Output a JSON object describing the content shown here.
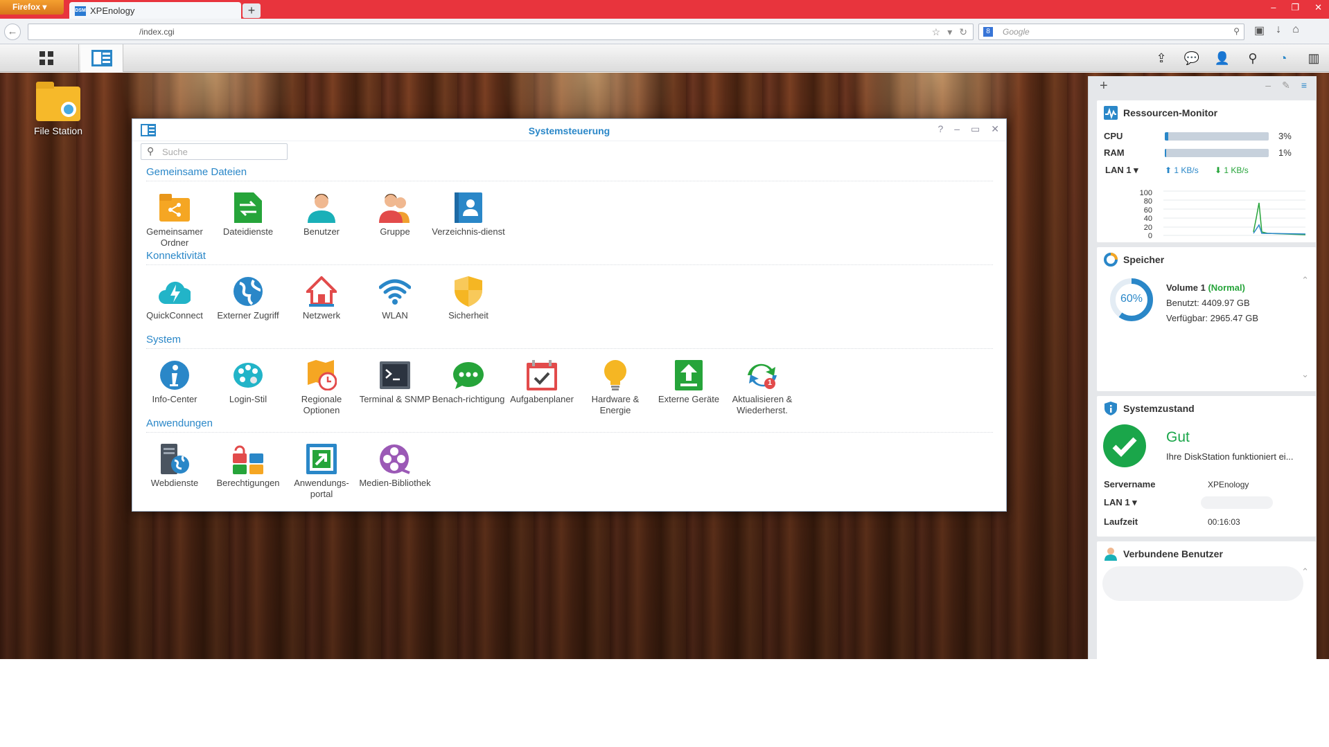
{
  "browser": {
    "menu_label": "Firefox",
    "tab_title": "XPEnology",
    "tab_favicon": "DSM",
    "new_tab": "+",
    "url": "/index.cgi",
    "search_placeholder": "Google"
  },
  "desktop": {
    "file_station_label": "File Station"
  },
  "window": {
    "title": "Systemsteuerung",
    "search_placeholder": "Suche",
    "sections": {
      "shared": {
        "title": "Gemeinsame Dateien",
        "items": [
          {
            "label": "Gemeinsamer Ordner",
            "icon": "shared-folder-icon"
          },
          {
            "label": "Dateidienste",
            "icon": "file-services-icon"
          },
          {
            "label": "Benutzer",
            "icon": "user-icon"
          },
          {
            "label": "Gruppe",
            "icon": "group-icon"
          },
          {
            "label": "Verzeichnis-dienst",
            "icon": "directory-icon"
          }
        ]
      },
      "connectivity": {
        "title": "Konnektivität",
        "items": [
          {
            "label": "QuickConnect",
            "icon": "quickconnect-icon"
          },
          {
            "label": "Externer Zugriff",
            "icon": "globe-icon"
          },
          {
            "label": "Netzwerk",
            "icon": "home-network-icon"
          },
          {
            "label": "WLAN",
            "icon": "wifi-icon"
          },
          {
            "label": "Sicherheit",
            "icon": "shield-icon"
          }
        ]
      },
      "system": {
        "title": "System",
        "items": [
          {
            "label": "Info-Center",
            "icon": "info-icon"
          },
          {
            "label": "Login-Stil",
            "icon": "palette-icon"
          },
          {
            "label": "Regionale Optionen",
            "icon": "region-clock-icon"
          },
          {
            "label": "Terminal & SNMP",
            "icon": "terminal-icon"
          },
          {
            "label": "Benach-richtigung",
            "icon": "chat-bubble-icon"
          },
          {
            "label": "Aufgabenplaner",
            "icon": "calendar-check-icon"
          },
          {
            "label": "Hardware & Energie",
            "icon": "lightbulb-icon"
          },
          {
            "label": "Externe Geräte",
            "icon": "upload-device-icon"
          },
          {
            "label": "Aktualisieren & Wiederherst.",
            "icon": "update-icon",
            "badge": "1"
          }
        ]
      },
      "apps": {
        "title": "Anwendungen",
        "items": [
          {
            "label": "Webdienste",
            "icon": "web-services-icon"
          },
          {
            "label": "Berechtigungen",
            "icon": "privileges-icon"
          },
          {
            "label": "Anwendungs-portal",
            "icon": "app-portal-icon"
          },
          {
            "label": "Medien-Bibliothek",
            "icon": "media-library-icon"
          }
        ]
      }
    }
  },
  "widgets": {
    "resource_monitor": {
      "title": "Ressourcen-Monitor",
      "cpu_label": "CPU",
      "cpu_value": "3%",
      "cpu_fraction": 0.03,
      "ram_label": "RAM",
      "ram_value": "1%",
      "ram_fraction": 0.01,
      "lan_label": "LAN 1",
      "up": "1 KB/s",
      "down": "1 KB/s",
      "chart_ticks": [
        "100",
        "80",
        "60",
        "40",
        "20",
        "0"
      ]
    },
    "storage": {
      "title": "Speicher",
      "percent_label": "60%",
      "percent": 60,
      "volume_name": "Volume 1",
      "volume_status": "(Normal)",
      "used": "Benutzt: 4409.97 GB",
      "free": "Verfügbar: 2965.47 GB"
    },
    "health": {
      "title": "Systemzustand",
      "status": "Gut",
      "message": "Ihre DiskStation funktioniert ei...",
      "server_label": "Servername",
      "server_value": "XPEnology",
      "lan_label": "LAN 1",
      "uptime_label": "Laufzeit",
      "uptime_value": "00:16:03"
    },
    "users": {
      "title": "Verbundene Benutzer"
    }
  },
  "colors": {
    "accent": "#2a87c8",
    "firefox_bar": "#e8343d",
    "good": "#1aa64a"
  }
}
